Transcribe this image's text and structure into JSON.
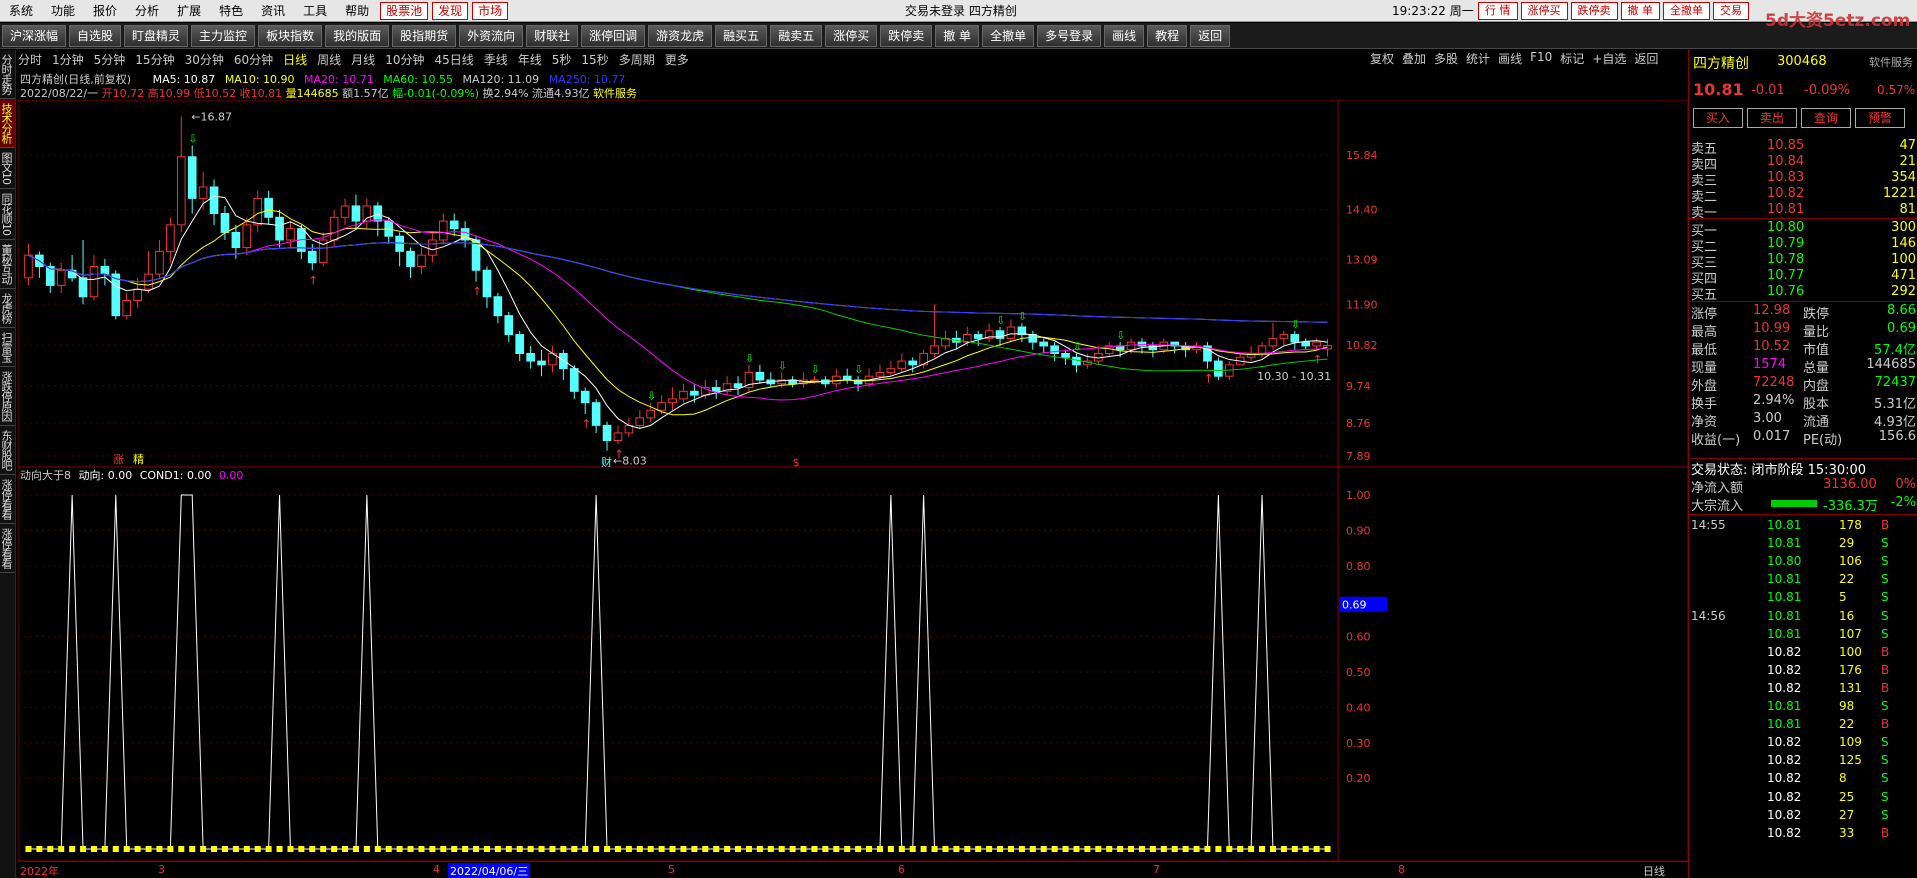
{
  "menu": {
    "items": [
      "系统",
      "功能",
      "报价",
      "分析",
      "扩展",
      "特色",
      "资讯",
      "工具",
      "帮助"
    ],
    "red_items": [
      "股票池",
      "发现",
      "市场"
    ],
    "title": "交易未登录  四方精创",
    "time": "19:23:22 周一",
    "right_btns": [
      "行 情",
      "涨停买",
      "跌停卖",
      "撤 单",
      "全撤单",
      "交易"
    ]
  },
  "toolbar": {
    "items": [
      "沪深涨幅",
      "自选股",
      "盯盘精灵",
      "主力监控",
      "板块指数",
      "我的版面",
      "股指期货",
      "外资流向",
      "财联社",
      "涨停回调",
      "游资龙虎",
      "融买五",
      "融卖五",
      "涨停买",
      "跌停卖",
      "撤 单",
      "全撤单",
      "多号登录",
      "画线",
      "教程",
      "返回"
    ]
  },
  "lefttabs": [
    "分时走势",
    "技术分析",
    "图文10",
    "同花顺10",
    "董秘互动",
    "龙虎榜",
    "扫雷宝",
    "涨跌停原因",
    "东财股吧",
    "涨停看看",
    "涨停看看"
  ],
  "periods": {
    "items": [
      "分时",
      "1分钟",
      "5分钟",
      "15分钟",
      "30分钟",
      "60分钟",
      "日线",
      "周线",
      "月线",
      "10分钟",
      "45日线",
      "季线",
      "年线",
      "5秒",
      "15秒",
      "多周期",
      "更多"
    ],
    "active": "日线"
  },
  "chart_btns": [
    "复权",
    "叠加",
    "多股",
    "统计",
    "画线",
    "F10",
    "标记",
    "+自选",
    "返回"
  ],
  "stockline": {
    "name": "四方精创(日线,前复权)",
    "ma5": "MA5: 10.87",
    "ma10": "MA10: 10.90",
    "ma20": "MA20: 10.71",
    "ma60": "MA60: 10.55",
    "ma120": "MA120: 11.09",
    "ma250": "MA250: 10.77"
  },
  "ohlc": {
    "date": "2022/08/22/一",
    "open": "开10.72",
    "high": "高10.99",
    "low": "低10.52",
    "close": "收10.81",
    "vol": "量144685",
    "amt": "额1.57亿",
    "chg": "幅-0.01(-0.09%)",
    "turn": "换2.94%",
    "float": "流通4.93亿",
    "service": "软件服务"
  },
  "annotations": {
    "high": "16.87",
    "low": "8.03",
    "range": "10.30 - 10.31",
    "zhang": "涨",
    "jing": "精",
    "cai": "财",
    "s_mark": "$"
  },
  "indicator": {
    "name": "动向大于8",
    "dx": "动向: 0.00",
    "cond": "COND1: 0.00",
    "purple": "0.00",
    "value_tag": "0.69"
  },
  "dates": {
    "items": [
      "2022年",
      "3",
      "4",
      "5",
      "6",
      "7",
      "8"
    ],
    "selected": "2022/04/06/三",
    "right": "日线"
  },
  "chart_data": {
    "type": "candlestick",
    "main_yticks": [
      "15.84",
      "14.40",
      "13.09",
      "11.90",
      "10.82",
      "9.74",
      "8.76",
      "7.89"
    ],
    "ind_yticks": [
      "1.00",
      "0.90",
      "0.80",
      "0.69",
      "0.60",
      "0.50",
      "0.40",
      "0.30",
      "0.20"
    ],
    "ylim": [
      7.89,
      16.87
    ],
    "candles": [
      [
        12.6,
        13.2,
        13.5,
        12.4
      ],
      [
        13.2,
        12.9,
        13.3,
        12.6
      ],
      [
        12.9,
        12.4,
        13.0,
        12.2
      ],
      [
        12.4,
        12.8,
        13.0,
        12.2
      ],
      [
        12.8,
        12.6,
        13.2,
        12.5
      ],
      [
        12.6,
        12.1,
        13.6,
        11.9
      ],
      [
        12.1,
        12.9,
        13.2,
        12.0
      ],
      [
        12.9,
        12.7,
        13.1,
        12.4
      ],
      [
        12.7,
        11.6,
        12.8,
        11.5
      ],
      [
        11.6,
        12.0,
        12.2,
        11.5
      ],
      [
        12.0,
        12.3,
        12.6,
        11.8
      ],
      [
        12.3,
        12.7,
        13.3,
        12.2
      ],
      [
        12.7,
        13.3,
        13.6,
        12.6
      ],
      [
        13.3,
        14.0,
        14.2,
        13.0
      ],
      [
        14.0,
        15.8,
        16.87,
        13.8
      ],
      [
        15.8,
        14.7,
        16.1,
        14.3
      ],
      [
        14.7,
        15.0,
        15.4,
        14.4
      ],
      [
        15.0,
        14.3,
        15.2,
        14.0
      ],
      [
        14.3,
        13.8,
        14.5,
        13.6
      ],
      [
        13.8,
        13.4,
        14.0,
        13.1
      ],
      [
        13.4,
        14.0,
        14.2,
        13.2
      ],
      [
        14.0,
        14.7,
        14.9,
        13.8
      ],
      [
        14.7,
        14.2,
        14.9,
        14.0
      ],
      [
        14.2,
        13.6,
        14.4,
        13.4
      ],
      [
        13.6,
        13.9,
        14.1,
        13.4
      ],
      [
        13.9,
        13.3,
        14.0,
        13.1
      ],
      [
        13.3,
        13.0,
        13.5,
        12.8
      ],
      [
        13.0,
        13.6,
        13.8,
        12.9
      ],
      [
        13.6,
        14.2,
        14.4,
        13.4
      ],
      [
        14.2,
        14.5,
        14.7,
        14.0
      ],
      [
        14.5,
        14.1,
        14.8,
        13.9
      ],
      [
        14.1,
        14.5,
        14.7,
        13.9
      ],
      [
        14.5,
        14.1,
        14.6,
        13.7
      ],
      [
        14.1,
        13.7,
        14.2,
        13.5
      ],
      [
        13.7,
        13.3,
        13.8,
        12.9
      ],
      [
        13.3,
        12.9,
        13.4,
        12.6
      ],
      [
        12.9,
        13.2,
        13.4,
        12.7
      ],
      [
        13.2,
        13.6,
        13.8,
        13.0
      ],
      [
        13.6,
        14.1,
        14.3,
        13.5
      ],
      [
        14.1,
        13.9,
        14.3,
        13.7
      ],
      [
        13.9,
        13.6,
        14.1,
        13.4
      ],
      [
        13.6,
        12.8,
        13.7,
        12.5
      ],
      [
        12.8,
        12.1,
        12.9,
        11.8
      ],
      [
        12.1,
        11.6,
        12.2,
        11.4
      ],
      [
        11.6,
        11.1,
        11.7,
        10.9
      ],
      [
        11.1,
        10.6,
        11.2,
        10.4
      ],
      [
        10.6,
        10.4,
        10.8,
        10.2
      ],
      [
        10.4,
        10.3,
        10.7,
        10.0
      ],
      [
        10.3,
        10.6,
        10.8,
        10.1
      ],
      [
        10.6,
        10.2,
        10.7,
        9.9
      ],
      [
        10.2,
        9.6,
        10.3,
        9.4
      ],
      [
        9.6,
        9.3,
        9.7,
        9.0
      ],
      [
        9.3,
        8.7,
        9.4,
        8.5
      ],
      [
        8.7,
        8.3,
        8.8,
        8.03
      ],
      [
        8.3,
        8.5,
        8.7,
        8.2
      ],
      [
        8.5,
        8.7,
        8.9,
        8.4
      ],
      [
        8.7,
        8.9,
        9.1,
        8.6
      ],
      [
        8.9,
        9.1,
        9.3,
        8.8
      ],
      [
        9.1,
        9.3,
        9.5,
        9.0
      ],
      [
        9.3,
        9.4,
        9.7,
        9.1
      ],
      [
        9.4,
        9.6,
        9.8,
        9.3
      ],
      [
        9.6,
        9.5,
        9.8,
        9.3
      ],
      [
        9.5,
        9.7,
        9.9,
        9.4
      ],
      [
        9.7,
        9.6,
        9.9,
        9.4
      ],
      [
        9.6,
        9.8,
        10.0,
        9.5
      ],
      [
        9.8,
        9.7,
        10.0,
        9.5
      ],
      [
        9.7,
        10.1,
        10.3,
        9.6
      ],
      [
        10.1,
        9.9,
        10.3,
        9.8
      ],
      [
        9.9,
        9.8,
        10.1,
        9.7
      ],
      [
        9.8,
        9.9,
        10.1,
        9.7
      ],
      [
        9.9,
        9.8,
        10.0,
        9.7
      ],
      [
        9.8,
        9.9,
        10.1,
        9.7
      ],
      [
        9.9,
        9.9,
        10.0,
        9.8
      ],
      [
        9.9,
        9.8,
        10.0,
        9.7
      ],
      [
        9.8,
        10.0,
        10.2,
        9.7
      ],
      [
        10.0,
        9.9,
        10.2,
        9.8
      ],
      [
        9.9,
        9.8,
        10.0,
        9.6
      ],
      [
        9.8,
        10.0,
        10.2,
        9.7
      ],
      [
        10.0,
        10.1,
        10.3,
        9.9
      ],
      [
        10.1,
        10.2,
        10.4,
        10.0
      ],
      [
        10.2,
        10.4,
        10.6,
        10.1
      ],
      [
        10.4,
        10.3,
        10.5,
        10.1
      ],
      [
        10.3,
        10.6,
        10.7,
        10.2
      ],
      [
        10.6,
        10.8,
        11.9,
        10.5
      ],
      [
        10.8,
        11.0,
        11.2,
        10.7
      ],
      [
        11.0,
        10.9,
        11.2,
        10.7
      ],
      [
        10.9,
        11.1,
        11.3,
        10.8
      ],
      [
        11.1,
        11.0,
        11.2,
        10.8
      ],
      [
        11.0,
        11.2,
        11.4,
        10.9
      ],
      [
        11.2,
        11.0,
        11.3,
        10.8
      ],
      [
        11.0,
        11.3,
        11.5,
        10.9
      ],
      [
        11.3,
        11.1,
        11.4,
        10.9
      ],
      [
        11.1,
        10.9,
        11.2,
        10.7
      ],
      [
        10.9,
        10.8,
        11.0,
        10.6
      ],
      [
        10.8,
        10.6,
        10.9,
        10.4
      ],
      [
        10.6,
        10.5,
        10.7,
        10.3
      ],
      [
        10.5,
        10.3,
        10.6,
        10.1
      ],
      [
        10.3,
        10.4,
        10.6,
        10.2
      ],
      [
        10.4,
        10.6,
        10.8,
        10.3
      ],
      [
        10.6,
        10.8,
        10.9,
        10.5
      ],
      [
        10.8,
        10.7,
        10.9,
        10.5
      ],
      [
        10.7,
        10.9,
        11.0,
        10.6
      ],
      [
        10.9,
        10.8,
        11.0,
        10.6
      ],
      [
        10.8,
        10.7,
        10.9,
        10.5
      ],
      [
        10.7,
        10.9,
        11.0,
        10.6
      ],
      [
        10.9,
        10.8,
        10.9,
        10.6
      ],
      [
        10.8,
        10.7,
        10.9,
        10.5
      ],
      [
        10.7,
        10.8,
        10.9,
        10.6
      ],
      [
        10.8,
        10.4,
        10.9,
        10.2
      ],
      [
        10.4,
        10.0,
        10.5,
        9.9
      ],
      [
        10.0,
        10.3,
        10.4,
        9.9
      ],
      [
        10.3,
        10.5,
        10.6,
        10.3
      ],
      [
        10.5,
        10.6,
        10.8,
        10.4
      ],
      [
        10.6,
        10.8,
        10.9,
        10.5
      ],
      [
        10.8,
        11.0,
        11.4,
        10.7
      ],
      [
        11.0,
        11.1,
        11.2,
        10.8
      ],
      [
        11.1,
        10.9,
        11.2,
        10.7
      ],
      [
        10.9,
        10.8,
        11.0,
        10.7
      ],
      [
        10.8,
        10.9,
        11.0,
        10.7
      ],
      [
        10.72,
        10.81,
        10.99,
        10.52
      ]
    ],
    "signals": [
      0,
      0,
      0,
      0,
      1,
      0,
      0,
      0,
      1,
      0,
      0,
      0,
      0,
      0,
      1,
      1,
      0,
      0,
      0,
      0,
      0,
      0,
      0,
      1,
      0,
      0,
      0,
      0,
      0,
      0,
      0,
      1,
      0,
      0,
      0,
      0,
      0,
      0,
      0,
      0,
      0,
      0,
      0,
      0,
      0,
      0,
      0,
      0,
      0,
      0,
      0,
      0,
      1,
      0,
      0,
      0,
      0,
      0,
      0,
      0,
      0,
      0,
      0,
      0,
      0,
      0,
      0,
      0,
      0,
      0,
      0,
      0,
      0,
      0,
      0,
      0,
      0,
      0,
      0,
      1,
      0,
      0,
      1,
      0,
      0,
      0,
      0,
      0,
      0,
      0,
      0,
      0,
      0,
      0,
      0,
      0,
      0,
      0,
      0,
      0,
      0,
      0,
      0,
      0,
      0,
      0,
      0,
      0,
      0,
      1,
      0,
      0,
      0,
      1,
      0,
      0,
      0,
      0,
      0,
      0
    ]
  },
  "right": {
    "name": "四方精创",
    "code": "300468",
    "sw": "软件服务",
    "price": "10.81",
    "chg": "-0.01",
    "pct": "-0.09%",
    "pct2": "0.57%",
    "btns": [
      "买入",
      "卖出",
      "查询",
      "预警"
    ],
    "asks": [
      [
        "卖五",
        "10.85",
        "47"
      ],
      [
        "卖四",
        "10.84",
        "21"
      ],
      [
        "卖三",
        "10.83",
        "354"
      ],
      [
        "卖二",
        "10.82",
        "1221"
      ],
      [
        "卖一",
        "10.81",
        "81"
      ]
    ],
    "bids": [
      [
        "买一",
        "10.80",
        "300"
      ],
      [
        "买二",
        "10.79",
        "146"
      ],
      [
        "买三",
        "10.78",
        "100"
      ],
      [
        "买四",
        "10.77",
        "471"
      ],
      [
        "买五",
        "10.76",
        "292"
      ]
    ],
    "stats": [
      [
        "涨停",
        "12.98",
        "跌停",
        "8.66"
      ],
      [
        "最高",
        "10.99",
        "量比",
        "0.69"
      ],
      [
        "最低",
        "10.52",
        "市值",
        "57.4亿"
      ],
      [
        "现量",
        "1574",
        "总量",
        "144685"
      ],
      [
        "外盘",
        "72248",
        "内盘",
        "72437"
      ],
      [
        "换手",
        "2.94%",
        "股本",
        "5.31亿"
      ],
      [
        "净资",
        "3.00",
        "流通",
        "4.93亿"
      ],
      [
        "收益(一)",
        "0.017",
        "PE(动)",
        "156.6"
      ]
    ],
    "trade_state": "交易状态: 闭市阶段 15:30:00",
    "netin": [
      "净流入额",
      "3136.00",
      "0%"
    ],
    "bigorder": [
      "大宗流入",
      "-336.3万",
      "-2%"
    ],
    "ticks": [
      [
        "14:55",
        "10.81",
        "178",
        "B"
      ],
      [
        "",
        "10.81",
        "29",
        "S"
      ],
      [
        "",
        "10.80",
        "106",
        "S"
      ],
      [
        "",
        "10.81",
        "22",
        "S"
      ],
      [
        "",
        "10.81",
        "5",
        "S"
      ],
      [
        "14:56",
        "10.81",
        "16",
        "S"
      ],
      [
        "",
        "10.81",
        "107",
        "S"
      ],
      [
        "",
        "10.82",
        "100",
        "B"
      ],
      [
        "",
        "10.82",
        "176",
        "B"
      ],
      [
        "",
        "10.82",
        "131",
        "B"
      ],
      [
        "",
        "10.81",
        "98",
        "S"
      ],
      [
        "",
        "10.81",
        "22",
        "B"
      ],
      [
        "",
        "10.82",
        "109",
        "S"
      ],
      [
        "",
        "10.82",
        "125",
        "S"
      ],
      [
        "",
        "10.82",
        "8",
        "S"
      ],
      [
        "",
        "10.82",
        "25",
        "S"
      ],
      [
        "",
        "10.82",
        "27",
        "S"
      ],
      [
        "",
        "10.82",
        "33",
        "B"
      ]
    ]
  },
  "watermark": "5d大资5etz.com"
}
